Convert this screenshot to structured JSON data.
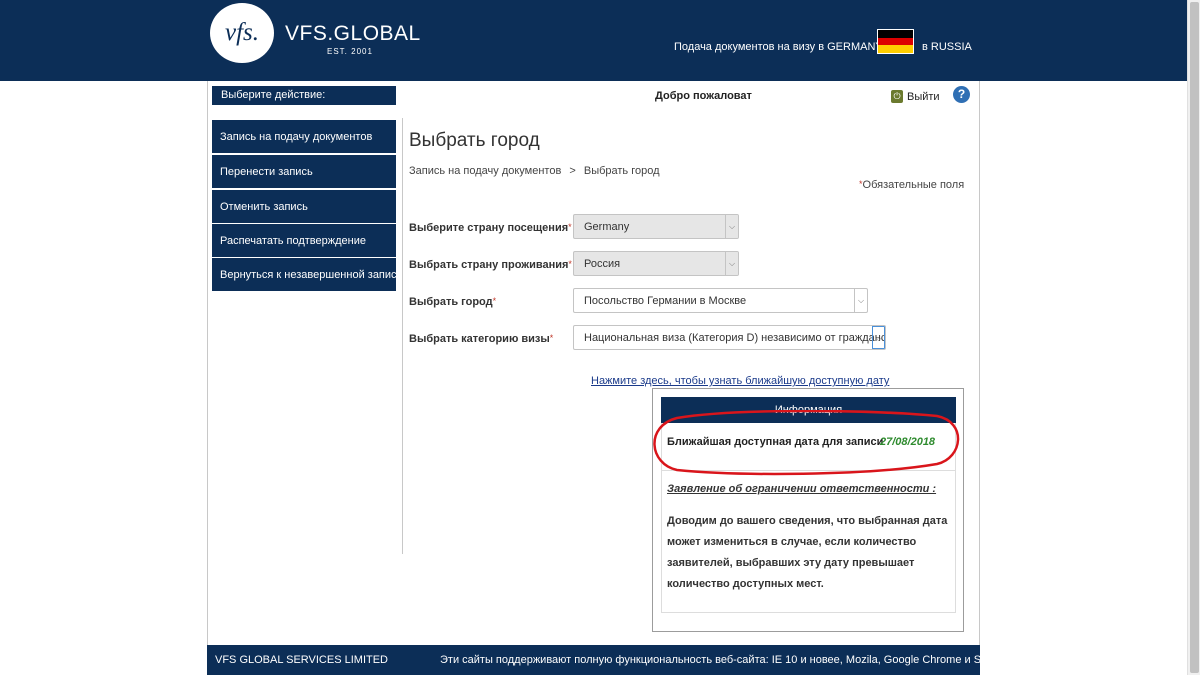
{
  "header": {
    "logo_mark": "vfs.",
    "logo_name": "VFS.GLOBAL",
    "logo_est": "EST. 2001",
    "visa_prefix": "Подача документов на визу в GERMANY",
    "visa_suffix": "в RUSSIA",
    "flag_colors": [
      "#000000",
      "#dd0000",
      "#ffce00"
    ]
  },
  "topbar": {
    "welcome": "Добро пожаловать",
    "logout_label": "Выйти",
    "help_icon": "?"
  },
  "sidebar": {
    "title": "Выберите действие:",
    "items": [
      {
        "label": "Запись на подачу документов"
      },
      {
        "label": "Перенести запись"
      },
      {
        "label": "Отменить запись"
      },
      {
        "label": "Распечатать подтверждение"
      },
      {
        "label": "Вернуться к незавершенной записи"
      }
    ]
  },
  "main": {
    "title": "Выбрать город",
    "breadcrumb": {
      "parent": "Запись на подачу документов",
      "separator": ">",
      "current": "Выбрать город"
    },
    "required_star": "*",
    "required_note": "Обязательные поля",
    "fields": [
      {
        "label": "Выберите страну посещения",
        "value": "Germany"
      },
      {
        "label": "Выбрать страну проживания",
        "value": "Россия"
      },
      {
        "label": "Выбрать город",
        "value": "Посольство Германии в Москве"
      },
      {
        "label": "Выбрать категорию визы",
        "value": "Национальная виза (Категория D) независимо от гражданства"
      }
    ],
    "nearest_link": "Нажмите здесь, чтобы узнать ближайшую доступную дату"
  },
  "info_popup": {
    "header": "Информация",
    "available_label": "Ближайшая доступная дата для записи",
    "available_date": "27/08/2018",
    "disclaimer_title": "Заявление об ограничении ответственности :",
    "disclaimer_lines": [
      "Доводим до вашего сведения, что выбранная дата",
      "может измениться в случае, если количество",
      "заявителей, выбравших эту дату превышает",
      "количество доступных мест."
    ],
    "highlight_color": "#d9151b"
  },
  "footer": {
    "company": "VFS GLOBAL SERVICES LIMITED",
    "support_note": "Эти сайты поддерживают полную функциональность веб-сайта: IE 10 и новее, Mozila, Google Chrome и Safari"
  },
  "colors": {
    "brand_navy": "#0c2e57",
    "date_green": "#2e8b2e",
    "link_blue": "#1a3a8a"
  }
}
